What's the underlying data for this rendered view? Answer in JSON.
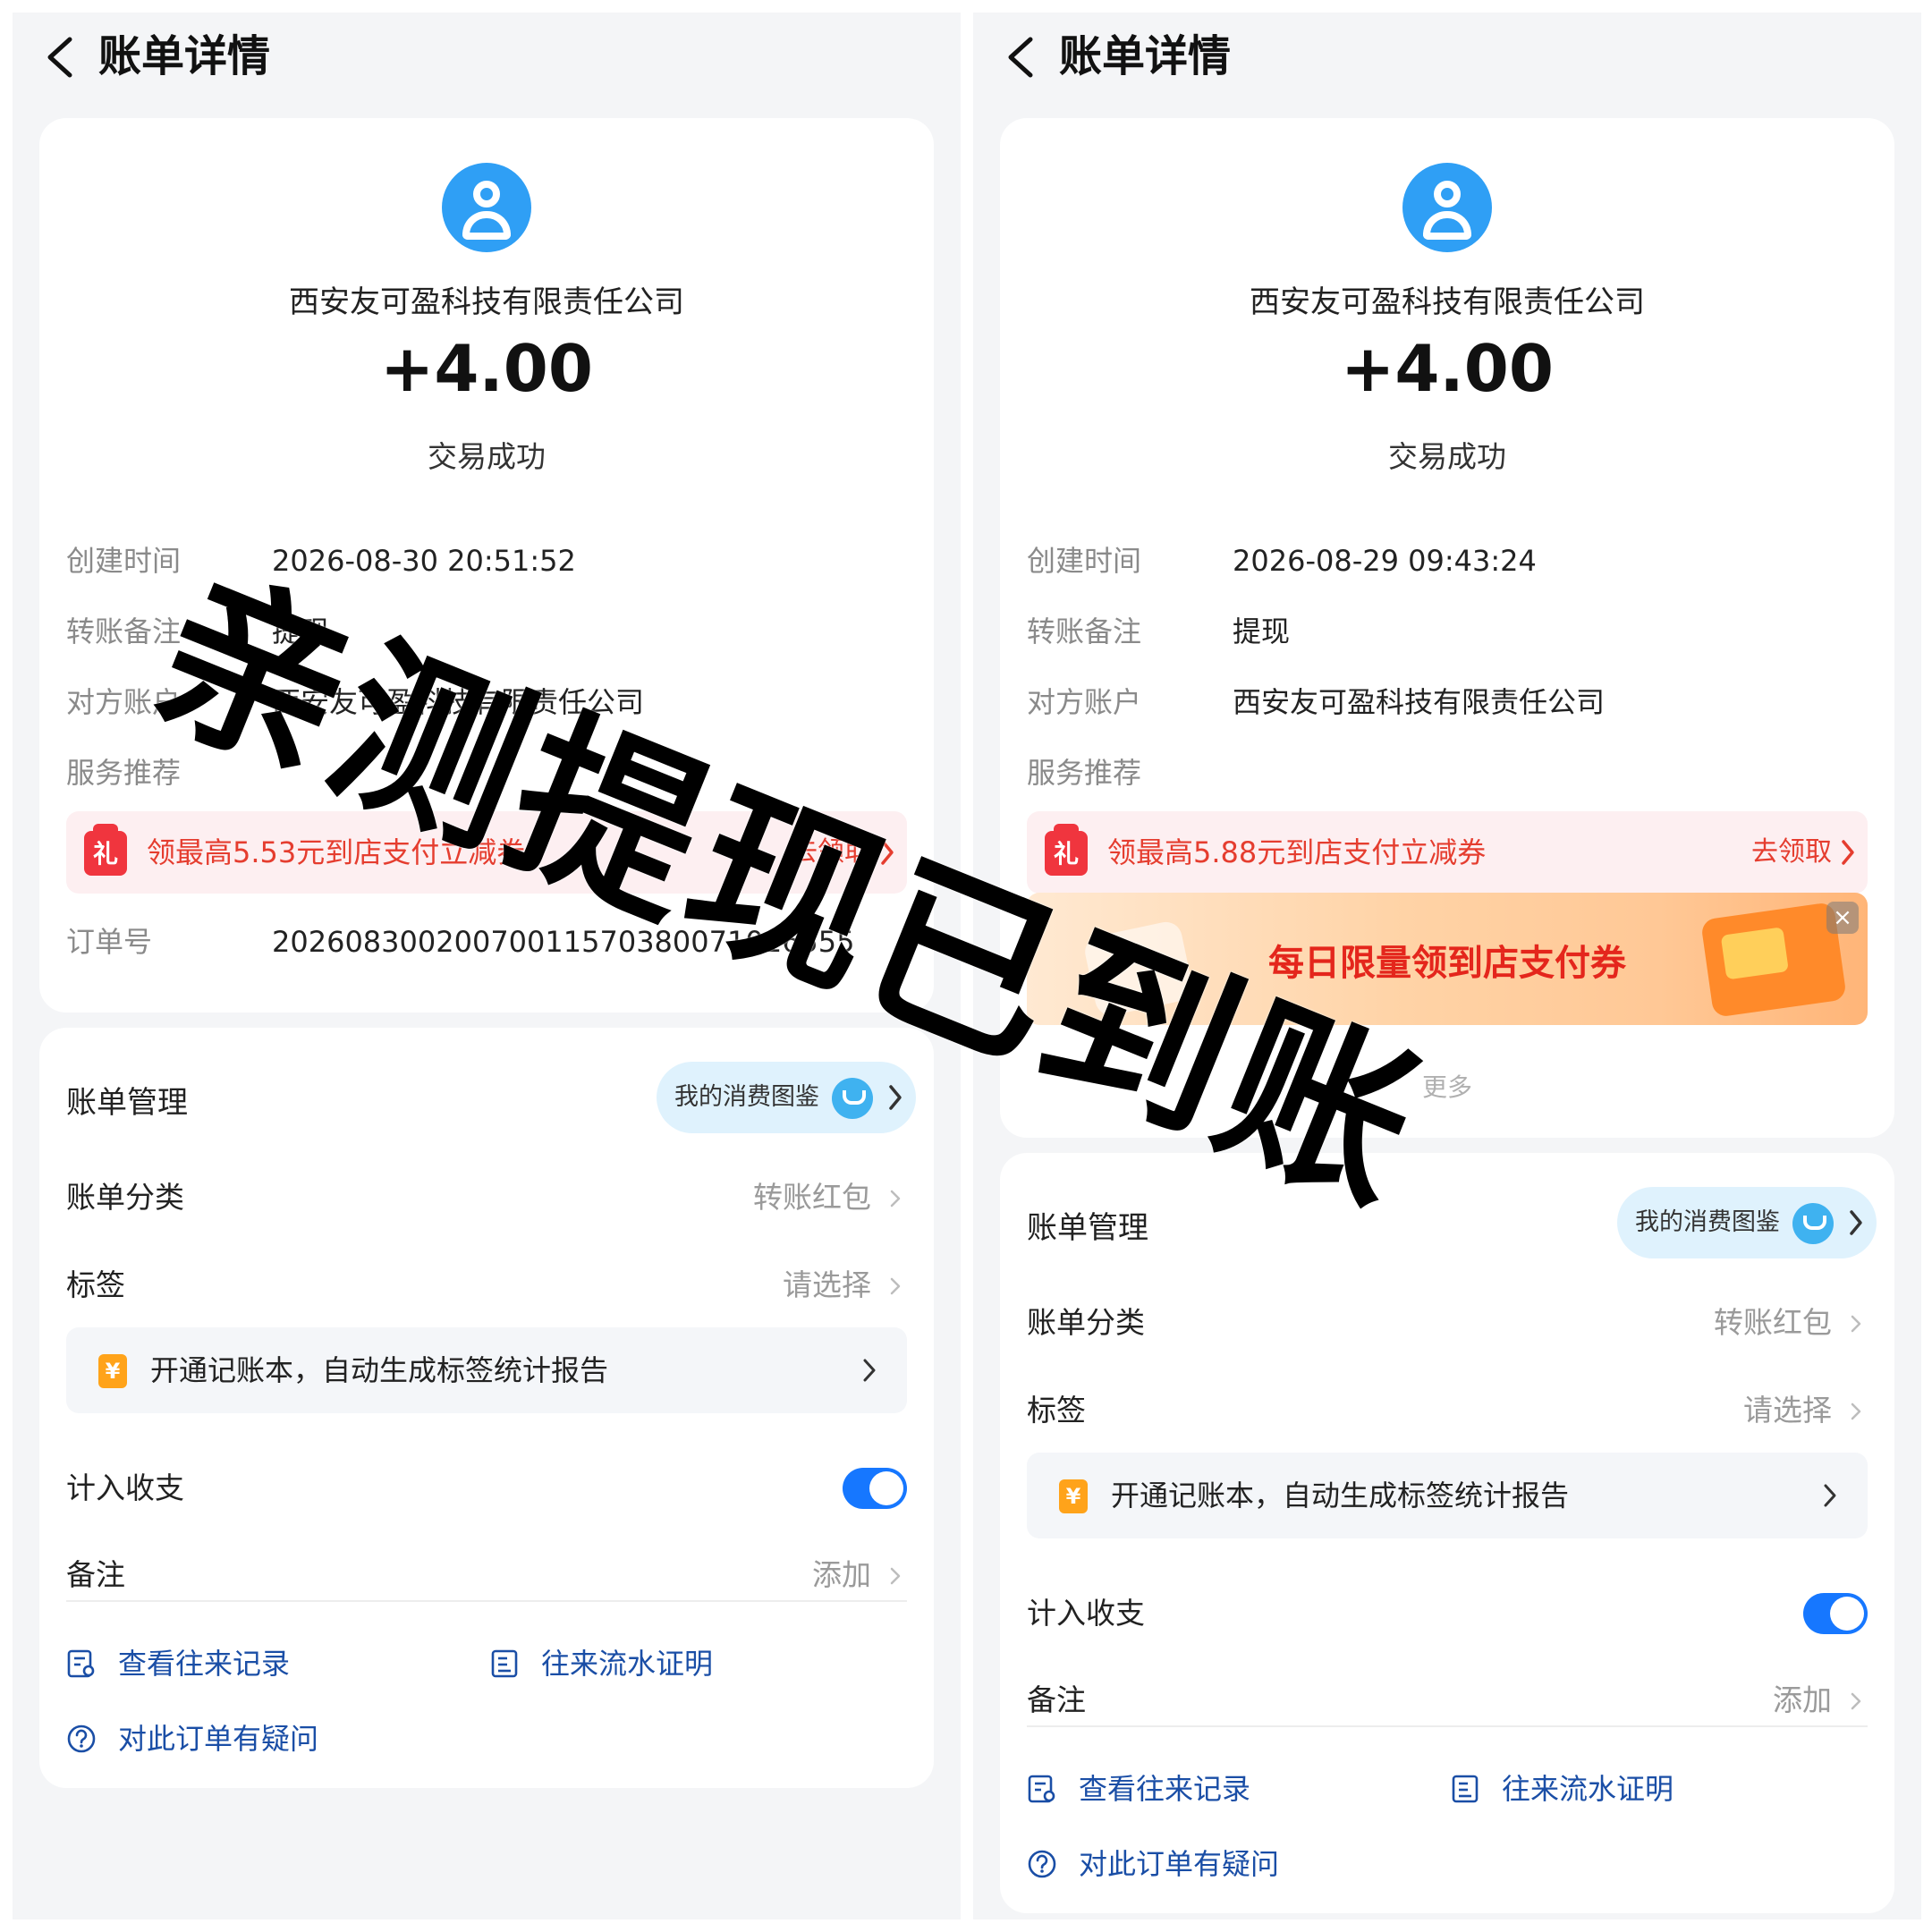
{
  "screens": {
    "left": {
      "nav": {
        "title": "账单详情",
        "back_icon": "chevron-left-icon"
      },
      "header": {
        "merchant": "西安友可盈科技有限责任公司",
        "amount": "+4.00",
        "status": "交易成功",
        "avatar_icon": "user-icon",
        "avatar_color": "#2f9ff5"
      },
      "details": {
        "created_label": "创建时间",
        "created_value": "2026-08-30 20:51:52",
        "remark_label": "转账备注",
        "remark_value": "提现",
        "counterparty_label": "对方账户",
        "counterparty_value": "西安友可盈科技有限责任公司",
        "service_label": "服务推荐",
        "order_label": "订单号",
        "order_value": "20260830020070011570380071016555"
      },
      "promo": {
        "gift_icon": "gift-icon",
        "gift_text": "礼",
        "text": "领最高5.53元到店支付立减券",
        "cta": "去领取"
      },
      "management": {
        "title": "账单管理",
        "pill_label": "我的消费图鉴",
        "category_label": "账单分类",
        "category_value": "转账红包",
        "tag_label": "标签",
        "tag_value": "请选择",
        "account_book_text": "开通记账本，自动生成标签统计报告",
        "yen_icon": "¥",
        "include_label": "计入收支",
        "note_label": "备注",
        "note_value": "添加"
      },
      "links": {
        "records": "查看往来记录",
        "proof": "往来流水证明",
        "question": "对此订单有疑问"
      }
    },
    "right": {
      "nav": {
        "title": "账单详情",
        "back_icon": "chevron-left-icon"
      },
      "header": {
        "merchant": "西安友可盈科技有限责任公司",
        "amount": "+4.00",
        "status": "交易成功",
        "avatar_icon": "user-icon",
        "avatar_color": "#2f9ff5"
      },
      "details": {
        "created_label": "创建时间",
        "created_value": "2026-08-29 09:43:24",
        "remark_label": "转账备注",
        "remark_value": "提现",
        "counterparty_label": "对方账户",
        "counterparty_value": "西安友可盈科技有限责任公司",
        "service_label": "服务推荐"
      },
      "promo": {
        "gift_icon": "gift-icon",
        "gift_text": "礼",
        "text": "领最高5.88元到店支付立减券",
        "cta": "去领取"
      },
      "banner": {
        "text": "每日限量领到店支付券",
        "close": "×"
      },
      "more": "更多",
      "management": {
        "title": "账单管理",
        "pill_label": "我的消费图鉴",
        "category_label": "账单分类",
        "category_value": "转账红包",
        "tag_label": "标签",
        "tag_value": "请选择",
        "account_book_text": "开通记账本，自动生成标签统计报告",
        "yen_icon": "¥",
        "include_label": "计入收支",
        "note_label": "备注",
        "note_value": "添加"
      },
      "links": {
        "records": "查看往来记录",
        "proof": "往来流水证明",
        "question": "对此订单有疑问"
      }
    }
  },
  "overlay": {
    "watermark": "亲测提现已到账"
  },
  "colors": {
    "accent": "#1677ff",
    "link": "#1a4ea6",
    "promo_red": "#e53d2f",
    "page_bg": "#f4f5f7"
  }
}
